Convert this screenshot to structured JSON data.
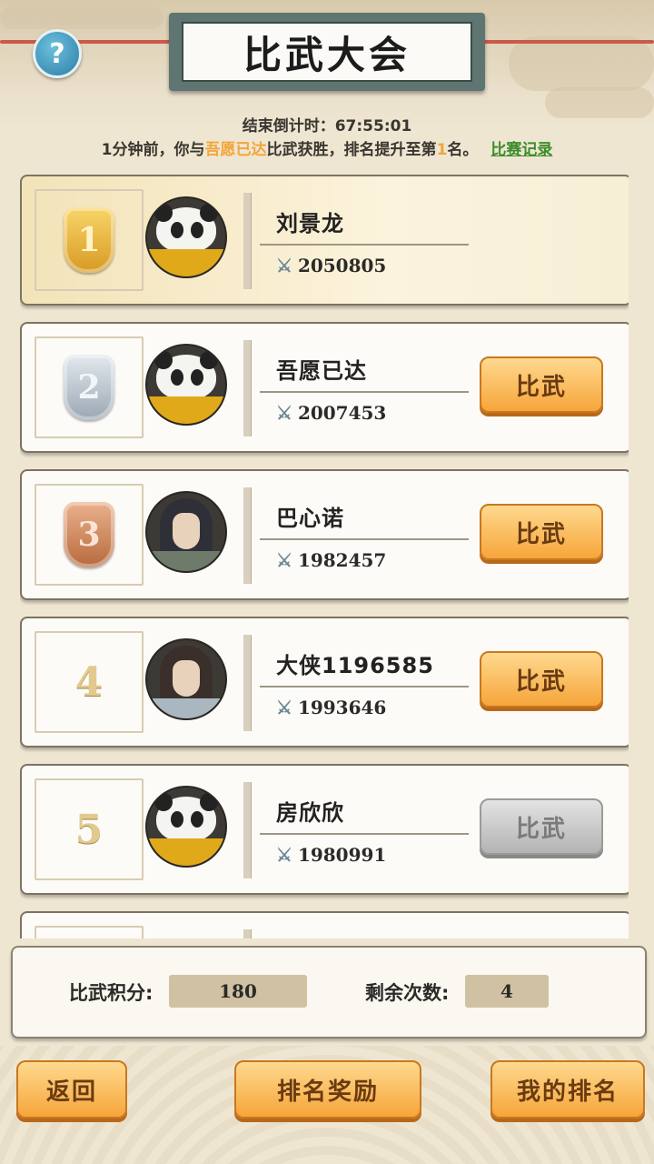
{
  "header": {
    "title": "比武大会",
    "help_label": "?"
  },
  "countdown": "结束倒计时：67:55:01",
  "notice": {
    "prefix": "1分钟前，你与",
    "opponent": "吾愿已达",
    "middle": "比武获胜，排名提升至第",
    "rank": "1",
    "suffix": "名。",
    "record_link": "比赛记录"
  },
  "ranking": [
    {
      "rank": "1",
      "name": "刘景龙",
      "power": "2050805",
      "button": ""
    },
    {
      "rank": "2",
      "name": "吾愿已达",
      "power": "2007453",
      "button": "比武"
    },
    {
      "rank": "3",
      "name": "巴心诺",
      "power": "1982457",
      "button": "比武"
    },
    {
      "rank": "4",
      "name": "大侠1196585",
      "power": "1993646",
      "button": "比武"
    },
    {
      "rank": "5",
      "name": "房欣欣",
      "power": "1980991",
      "button": "比武"
    }
  ],
  "score_panel": {
    "points_label": "比武积分:",
    "points_value": "180",
    "remaining_label": "剩余次数:",
    "remaining_value": "4"
  },
  "footer": {
    "back": "返回",
    "rewards": "排名奖励",
    "my_rank": "我的排名"
  },
  "icons": {
    "power": "crossed-swords-icon",
    "help": "question-icon"
  },
  "colors": {
    "accent_orange": "#f6a53a",
    "link_green": "#3c8d2a",
    "highlight": "#f2a53a"
  }
}
